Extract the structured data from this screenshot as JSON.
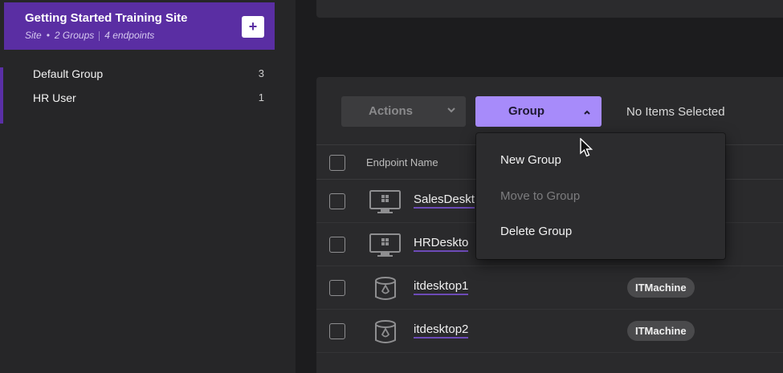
{
  "sidebar": {
    "site": {
      "title": "Getting Started Training Site",
      "type": "Site",
      "groups": "2 Groups",
      "endpoints": "4 endpoints",
      "add_label": "+"
    },
    "groups": [
      {
        "label": "Default Group",
        "count": "3"
      },
      {
        "label": "HR User",
        "count": "1"
      }
    ]
  },
  "toolbar": {
    "actions_label": "Actions",
    "group_label": "Group",
    "selection_status": "No Items Selected"
  },
  "table": {
    "columns": {
      "name": "Endpoint Name"
    },
    "rows": [
      {
        "name": "SalesDeskt",
        "icon": "monitor-icon",
        "tag": ""
      },
      {
        "name": "HRDeskto",
        "icon": "monitor-icon",
        "tag": ""
      },
      {
        "name": "itdesktop1",
        "icon": "database-icon",
        "tag": "ITMachine"
      },
      {
        "name": "itdesktop2",
        "icon": "database-icon",
        "tag": "ITMachine"
      }
    ]
  },
  "group_menu": {
    "items": [
      {
        "label": "New Group",
        "enabled": true
      },
      {
        "label": "Move to Group",
        "enabled": false
      },
      {
        "label": "Delete Group",
        "enabled": true
      }
    ]
  },
  "colors": {
    "accent": "#a78bfa",
    "site_header": "#5a2ea3",
    "link_underline": "#6d4bb8"
  }
}
